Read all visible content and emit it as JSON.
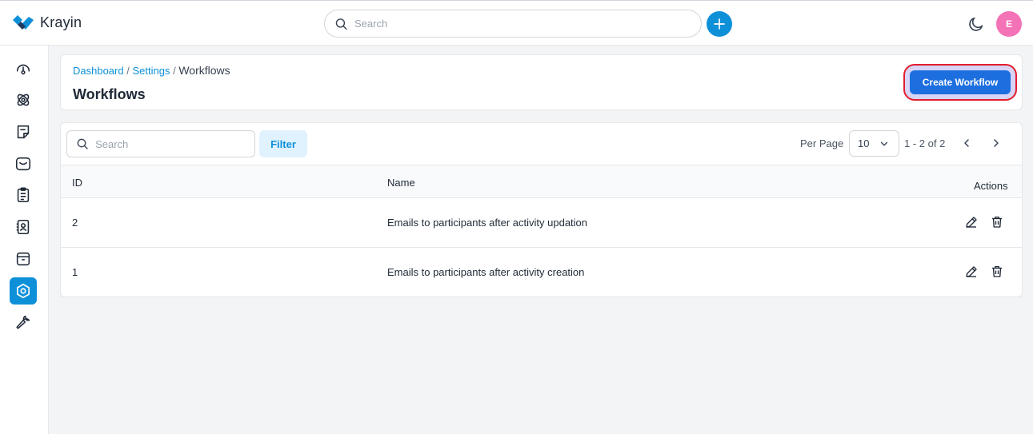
{
  "app": {
    "logo_text": "Krayin"
  },
  "topbar": {
    "search_placeholder": "Search",
    "avatar_initial": "E"
  },
  "sidebar": {
    "items": [
      {
        "name": "dashboard",
        "icon": "gauge-icon"
      },
      {
        "name": "leads",
        "icon": "leads-icon"
      },
      {
        "name": "quotes",
        "icon": "sticky-note-icon"
      },
      {
        "name": "mail",
        "icon": "mail-icon"
      },
      {
        "name": "activities",
        "icon": "clipboard-icon"
      },
      {
        "name": "contacts",
        "icon": "contact-book-icon"
      },
      {
        "name": "products",
        "icon": "archive-box-icon"
      },
      {
        "name": "settings",
        "icon": "settings-hex-icon",
        "active": true
      },
      {
        "name": "configuration",
        "icon": "wrench-icon"
      }
    ]
  },
  "breadcrumb": {
    "dashboard": "Dashboard",
    "settings": "Settings",
    "current": "Workflows",
    "sep": "/"
  },
  "page": {
    "title": "Workflows",
    "create_button": "Create Workflow"
  },
  "toolbar": {
    "search_placeholder": "Search",
    "filter_label": "Filter",
    "per_page_label": "Per Page",
    "per_page_value": "10",
    "page_info": "1 - 2 of 2"
  },
  "table": {
    "columns": {
      "id": "ID",
      "name": "Name",
      "actions": "Actions"
    },
    "rows": [
      {
        "id": "2",
        "name": "Emails to participants after activity updation"
      },
      {
        "id": "1",
        "name": "Emails to participants after activity creation"
      }
    ]
  },
  "colors": {
    "accent": "#0e90d9",
    "primary_button": "#1d6fe0",
    "avatar": "#f472b6",
    "highlight": "#e11d2e"
  }
}
